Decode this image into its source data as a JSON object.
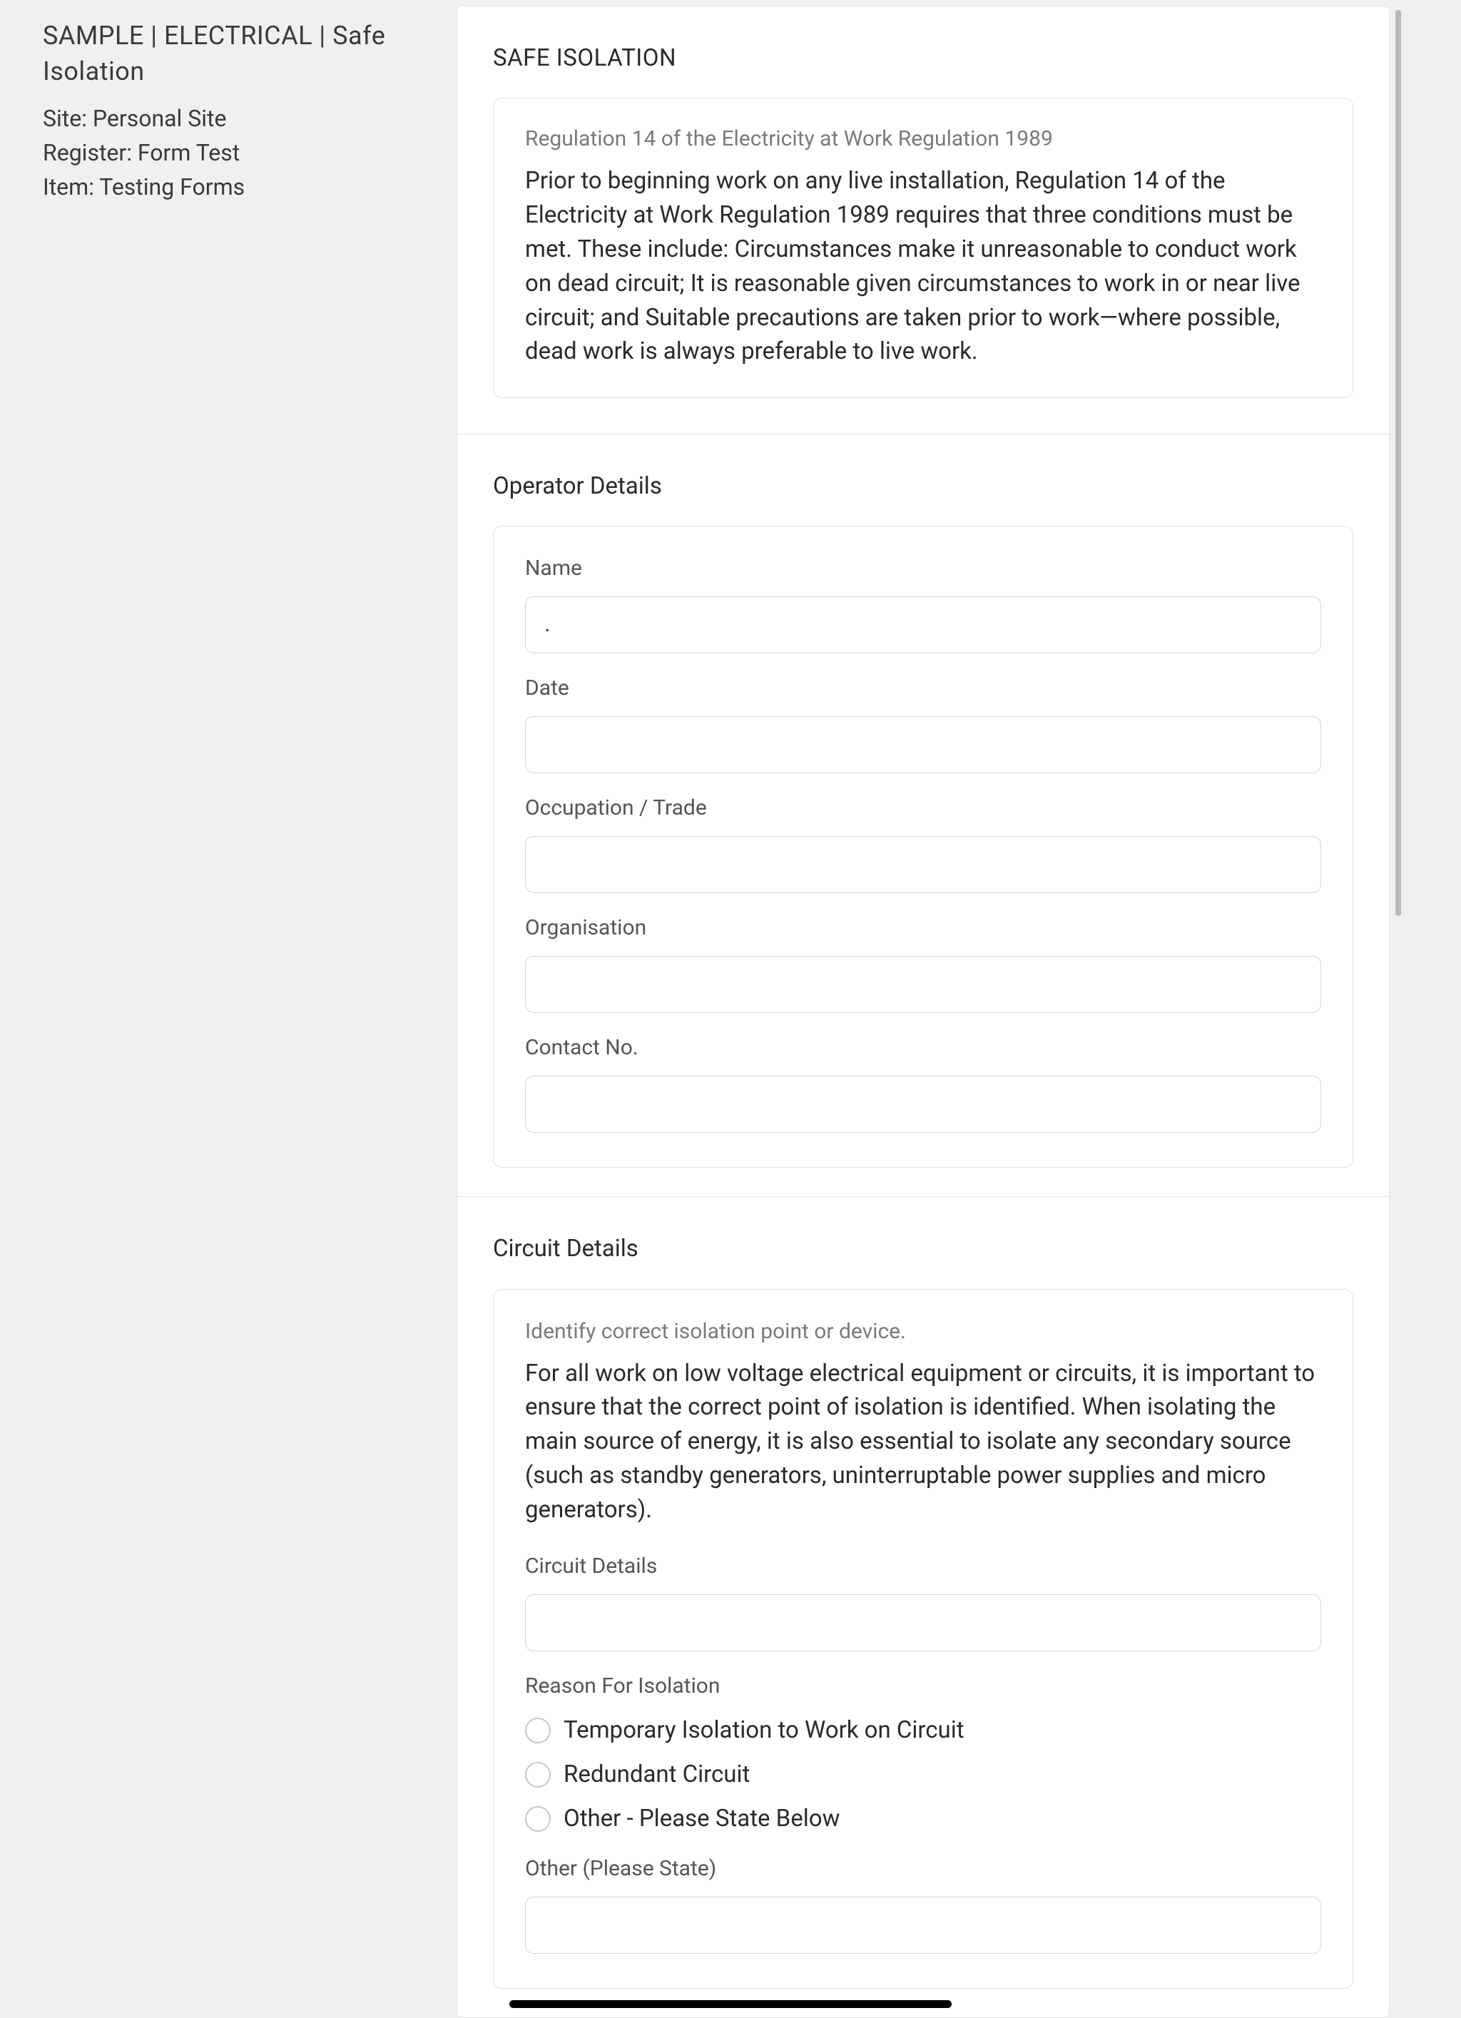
{
  "sidebar": {
    "title": "SAMPLE | ELECTRICAL | Safe Isolation",
    "site": "Site: Personal Site",
    "register": "Register: Form Test",
    "item": "Item: Testing Forms"
  },
  "sections": {
    "safe_isolation": {
      "heading": "SAFE ISOLATION",
      "info_title": "Regulation 14 of the Electricity at Work Regulation 1989",
      "info_body": "Prior to beginning work on any live installation, Regulation 14 of the Electricity at Work Regulation 1989 requires that three conditions must be met. These include: Circumstances make it unreasonable to conduct work on dead circuit; It is reasonable given circumstances to work in or near live circuit; and Suitable precautions are taken prior to work—where possible, dead work is always preferable to live work."
    },
    "operator": {
      "heading": "Operator Details",
      "fields": {
        "name": {
          "label": "Name",
          "value": "."
        },
        "date": {
          "label": "Date",
          "value": ""
        },
        "occupation": {
          "label": "Occupation / Trade",
          "value": ""
        },
        "organisation": {
          "label": "Organisation",
          "value": ""
        },
        "contact": {
          "label": "Contact No.",
          "value": ""
        }
      }
    },
    "circuit": {
      "heading": "Circuit Details",
      "info_title": "Identify correct isolation point or device.",
      "info_body": "For all work on low voltage electrical equipment or circuits, it is important to ensure that the correct point of isolation is identified. When isolating the main source of energy, it is also essential to isolate any secondary source (such as standby generators, uninterruptable power supplies and micro generators).",
      "fields": {
        "circuit_details": {
          "label": "Circuit Details",
          "value": ""
        },
        "reason_label": "Reason For Isolation",
        "reason_options": [
          "Temporary Isolation to Work on Circuit",
          "Redundant Circuit",
          "Other - Please State Below"
        ],
        "other": {
          "label": "Other (Please State)",
          "value": ""
        }
      }
    }
  }
}
